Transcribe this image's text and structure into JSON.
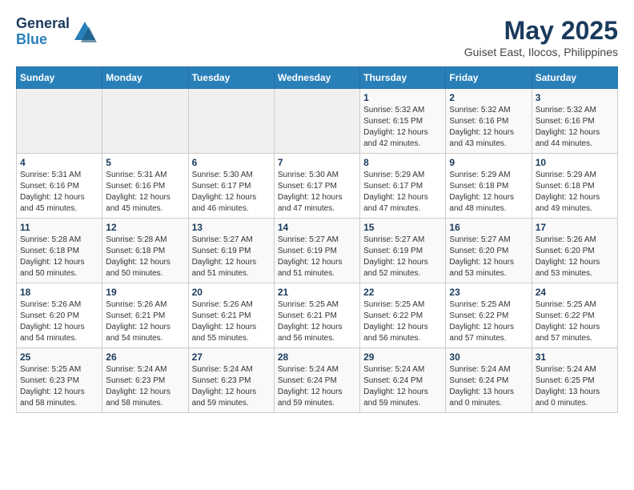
{
  "header": {
    "logo_line1": "General",
    "logo_line2": "Blue",
    "title": "May 2025",
    "subtitle": "Guiset East, Ilocos, Philippines"
  },
  "weekdays": [
    "Sunday",
    "Monday",
    "Tuesday",
    "Wednesday",
    "Thursday",
    "Friday",
    "Saturday"
  ],
  "weeks": [
    [
      {
        "day": "",
        "info": ""
      },
      {
        "day": "",
        "info": ""
      },
      {
        "day": "",
        "info": ""
      },
      {
        "day": "",
        "info": ""
      },
      {
        "day": "1",
        "info": "Sunrise: 5:32 AM\nSunset: 6:15 PM\nDaylight: 12 hours\nand 42 minutes."
      },
      {
        "day": "2",
        "info": "Sunrise: 5:32 AM\nSunset: 6:16 PM\nDaylight: 12 hours\nand 43 minutes."
      },
      {
        "day": "3",
        "info": "Sunrise: 5:32 AM\nSunset: 6:16 PM\nDaylight: 12 hours\nand 44 minutes."
      }
    ],
    [
      {
        "day": "4",
        "info": "Sunrise: 5:31 AM\nSunset: 6:16 PM\nDaylight: 12 hours\nand 45 minutes."
      },
      {
        "day": "5",
        "info": "Sunrise: 5:31 AM\nSunset: 6:16 PM\nDaylight: 12 hours\nand 45 minutes."
      },
      {
        "day": "6",
        "info": "Sunrise: 5:30 AM\nSunset: 6:17 PM\nDaylight: 12 hours\nand 46 minutes."
      },
      {
        "day": "7",
        "info": "Sunrise: 5:30 AM\nSunset: 6:17 PM\nDaylight: 12 hours\nand 47 minutes."
      },
      {
        "day": "8",
        "info": "Sunrise: 5:29 AM\nSunset: 6:17 PM\nDaylight: 12 hours\nand 47 minutes."
      },
      {
        "day": "9",
        "info": "Sunrise: 5:29 AM\nSunset: 6:18 PM\nDaylight: 12 hours\nand 48 minutes."
      },
      {
        "day": "10",
        "info": "Sunrise: 5:29 AM\nSunset: 6:18 PM\nDaylight: 12 hours\nand 49 minutes."
      }
    ],
    [
      {
        "day": "11",
        "info": "Sunrise: 5:28 AM\nSunset: 6:18 PM\nDaylight: 12 hours\nand 50 minutes."
      },
      {
        "day": "12",
        "info": "Sunrise: 5:28 AM\nSunset: 6:18 PM\nDaylight: 12 hours\nand 50 minutes."
      },
      {
        "day": "13",
        "info": "Sunrise: 5:27 AM\nSunset: 6:19 PM\nDaylight: 12 hours\nand 51 minutes."
      },
      {
        "day": "14",
        "info": "Sunrise: 5:27 AM\nSunset: 6:19 PM\nDaylight: 12 hours\nand 51 minutes."
      },
      {
        "day": "15",
        "info": "Sunrise: 5:27 AM\nSunset: 6:19 PM\nDaylight: 12 hours\nand 52 minutes."
      },
      {
        "day": "16",
        "info": "Sunrise: 5:27 AM\nSunset: 6:20 PM\nDaylight: 12 hours\nand 53 minutes."
      },
      {
        "day": "17",
        "info": "Sunrise: 5:26 AM\nSunset: 6:20 PM\nDaylight: 12 hours\nand 53 minutes."
      }
    ],
    [
      {
        "day": "18",
        "info": "Sunrise: 5:26 AM\nSunset: 6:20 PM\nDaylight: 12 hours\nand 54 minutes."
      },
      {
        "day": "19",
        "info": "Sunrise: 5:26 AM\nSunset: 6:21 PM\nDaylight: 12 hours\nand 54 minutes."
      },
      {
        "day": "20",
        "info": "Sunrise: 5:26 AM\nSunset: 6:21 PM\nDaylight: 12 hours\nand 55 minutes."
      },
      {
        "day": "21",
        "info": "Sunrise: 5:25 AM\nSunset: 6:21 PM\nDaylight: 12 hours\nand 56 minutes."
      },
      {
        "day": "22",
        "info": "Sunrise: 5:25 AM\nSunset: 6:22 PM\nDaylight: 12 hours\nand 56 minutes."
      },
      {
        "day": "23",
        "info": "Sunrise: 5:25 AM\nSunset: 6:22 PM\nDaylight: 12 hours\nand 57 minutes."
      },
      {
        "day": "24",
        "info": "Sunrise: 5:25 AM\nSunset: 6:22 PM\nDaylight: 12 hours\nand 57 minutes."
      }
    ],
    [
      {
        "day": "25",
        "info": "Sunrise: 5:25 AM\nSunset: 6:23 PM\nDaylight: 12 hours\nand 58 minutes."
      },
      {
        "day": "26",
        "info": "Sunrise: 5:24 AM\nSunset: 6:23 PM\nDaylight: 12 hours\nand 58 minutes."
      },
      {
        "day": "27",
        "info": "Sunrise: 5:24 AM\nSunset: 6:23 PM\nDaylight: 12 hours\nand 59 minutes."
      },
      {
        "day": "28",
        "info": "Sunrise: 5:24 AM\nSunset: 6:24 PM\nDaylight: 12 hours\nand 59 minutes."
      },
      {
        "day": "29",
        "info": "Sunrise: 5:24 AM\nSunset: 6:24 PM\nDaylight: 12 hours\nand 59 minutes."
      },
      {
        "day": "30",
        "info": "Sunrise: 5:24 AM\nSunset: 6:24 PM\nDaylight: 13 hours\nand 0 minutes."
      },
      {
        "day": "31",
        "info": "Sunrise: 5:24 AM\nSunset: 6:25 PM\nDaylight: 13 hours\nand 0 minutes."
      }
    ]
  ]
}
